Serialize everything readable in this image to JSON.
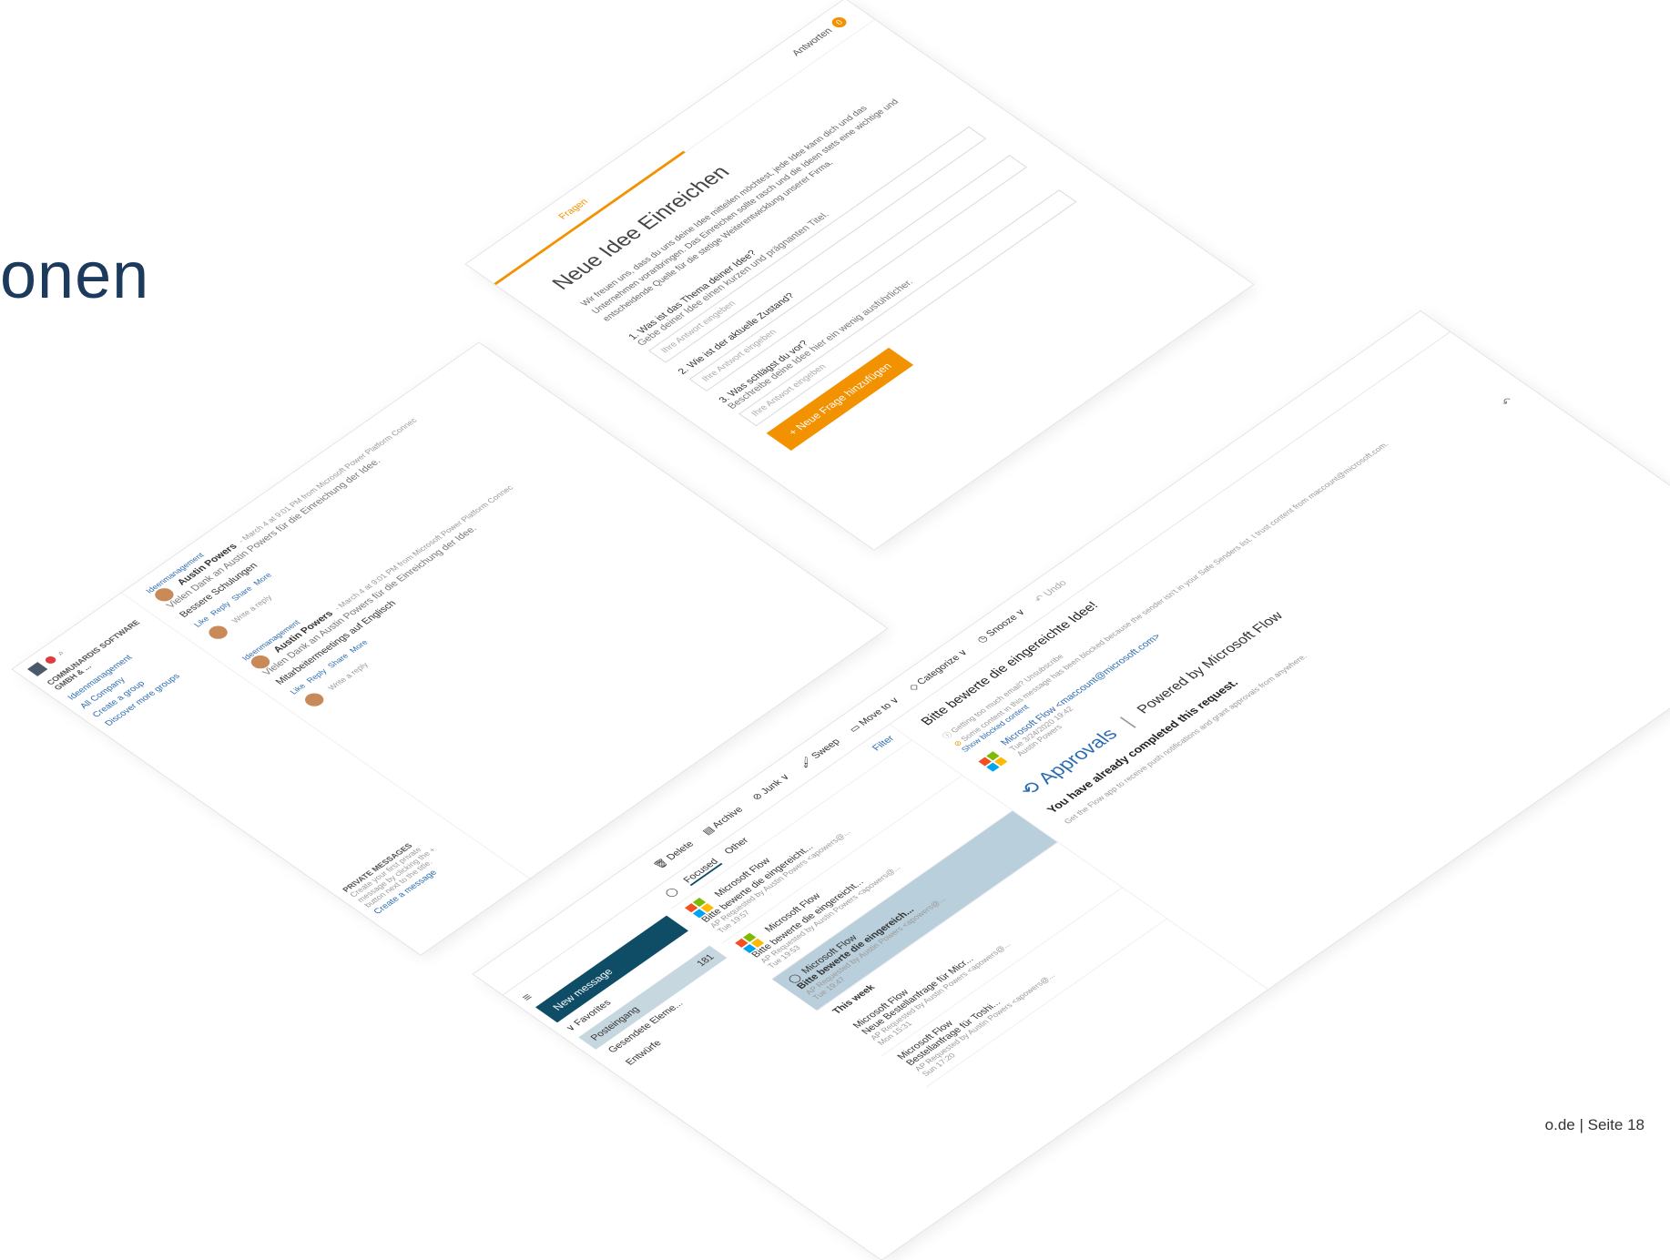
{
  "slide": {
    "title_fragment": "onen",
    "footer": "o.de | Seite 18"
  },
  "colors": {
    "title": "#1b3a5c",
    "accent_orange": "#f39200",
    "outlook_primary": "#0f4c66",
    "selected_mail": "#b9cfdb"
  },
  "form": {
    "tab_questions": "Fragen",
    "tab_answers": "Antworten",
    "answers_badge": "0",
    "title": "Neue Idee Einreichen",
    "intro": "Wir freuen uns, dass du uns deine Idee mitteilen möchtest, jede Idee kann dich und das Unternehmen voranbringen. Das Einreichen sollte rasch und die Ideen stets eine wichtige und entscheidende Quelle für die stetige Weiterentwicklung unserer Firma.",
    "questions": [
      {
        "label": "1. Was ist das Thema deiner Idee?",
        "hint": "Gebe deiner Idee einen kurzen und prägnanten Titel.",
        "placeholder": "Ihre Antwort eingeben"
      },
      {
        "label": "2. Wie ist der aktuelle Zustand?",
        "hint": "",
        "placeholder": "Ihre Antwort eingeben"
      },
      {
        "label": "3. Was schlägst du vor?",
        "hint": "Beschreibe deine Idee hier ein wenig ausführlicher.",
        "placeholder": "Ihre Antwort eingeben"
      }
    ],
    "add_question_button": "Neue Frage hinzufügen"
  },
  "yammer": {
    "org_name": "COMMUNARDIS SOFTWARE GMBH & ...",
    "sidebar_links": [
      "Ideenmanagement",
      "All Company",
      "Create a group",
      "Discover more groups"
    ],
    "posts": [
      {
        "group": "Ideenmanagement",
        "author": "Austin Powers",
        "meta": "- March 4 at 9:01 PM from Microsoft Power Platform Connec",
        "body": "Vielen Dank an Austin Powers für die Einreichung der Idee.",
        "subject": "Bessere Schulungen",
        "actions": [
          "Like",
          "Reply",
          "Share",
          "More"
        ],
        "reply_placeholder": "Write a reply"
      },
      {
        "group": "Ideenmanagement",
        "author": "Austin Powers",
        "meta": "- March 4 at 9:01 PM from Microsoft Power Platform Connec",
        "body": "Vielen Dank an Austin Powers für die Einreichung der Idee.",
        "subject": "Mitarbeitermeetings auf Englisch",
        "actions": [
          "Like",
          "Reply",
          "Share",
          "More"
        ],
        "reply_placeholder": "Write a reply"
      }
    ],
    "private_messages": {
      "title": "PRIVATE MESSAGES",
      "text": "Create your first private message by clicking the + button next to the title.",
      "link": "Create a message"
    }
  },
  "outlook": {
    "new_message": "New message",
    "favorites": "Favorites",
    "inbox": "Posteingang",
    "inbox_count": "181",
    "sent": "Gesendete Eleme...",
    "drafts": "Entwürfe",
    "toolbar": [
      "Delete",
      "Archive",
      "Junk",
      "Sweep",
      "Move to",
      "Categorize",
      "Snooze",
      "Undo"
    ],
    "tabs": {
      "focused": "Focused",
      "other": "Other",
      "filter": "Filter"
    },
    "mails": [
      {
        "sender": "Microsoft Flow",
        "subject": "Bitte bewerte die eingereicht...",
        "preview": "AP Requested by Austin Powers <apowers@...",
        "time": "Tue 19:57",
        "selected": false
      },
      {
        "sender": "Microsoft Flow",
        "subject": "Bitte bewerte die eingereicht...",
        "preview": "AP Requested by Austin Powers <apowers@...",
        "time": "Tue 19:53",
        "selected": false
      },
      {
        "sender": "Microsoft Flow",
        "subject": "Bitte bewerte die eingereich...",
        "preview": "AP Requested by Austin Powers <apowers@...",
        "time": "Tue 19:47",
        "selected": true
      }
    ],
    "section_this_week": "This week",
    "week_mails": [
      {
        "sender": "Microsoft Flow",
        "subject": "Neue Bestellanfrage für Micr...",
        "preview": "AP Requested by Austin Powers <apowers@...",
        "time": "Mon 15:31"
      },
      {
        "sender": "Microsoft Flow",
        "subject": "Bestellanfrage für Toshi...",
        "preview": "AP Requested by Austin Powers <apowers@...",
        "time": "Sun 17:20"
      }
    ],
    "reading": {
      "subject": "Bitte bewerte die eingereichte Idee!",
      "notice1": "Getting too much email? Unsubscribe",
      "notice2": "Some content in this message has been blocked because the sender isn't in your Safe Senders list. I trust content from maccount@microsoft.com.",
      "notice2_link": "Show blocked content",
      "from": "Microsoft Flow <maccount@microsoft.com>",
      "date": "Tue 3/24/2020 19:42",
      "to": "Austin Powers",
      "approvals_label": "Approvals",
      "powered_by": "Powered by Microsoft Flow",
      "completed": "You have already completed this request.",
      "footer": "Get the Flow app to receive push notifications and grant approvals from anywhere."
    }
  }
}
